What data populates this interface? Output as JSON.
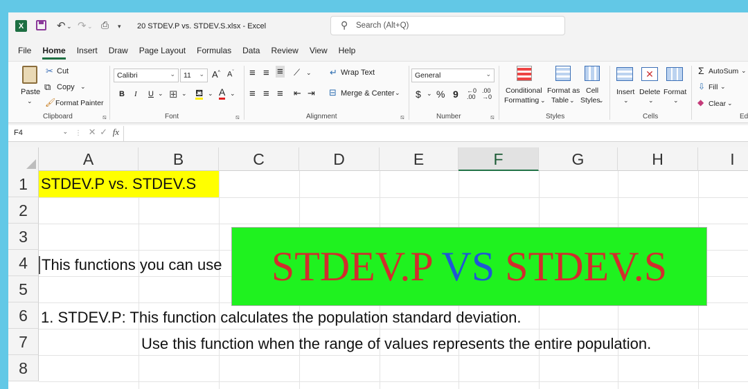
{
  "titlebar": {
    "app_icon": "excel-logo-icon",
    "app_letter": "X",
    "filename": "20 STDEV.P vs. STDEV.S.xlsx",
    "separator": "-",
    "app_name": "Excel",
    "search_placeholder": "Search (Alt+Q)"
  },
  "menu": [
    "File",
    "Home",
    "Insert",
    "Draw",
    "Page Layout",
    "Formulas",
    "Data",
    "Review",
    "View",
    "Help"
  ],
  "ribbon": {
    "clipboard": {
      "paste": "Paste",
      "cut": "Cut",
      "copy": "Copy",
      "format_painter": "Format Painter",
      "label": "Clipboard"
    },
    "font": {
      "name": "Calibri",
      "size": "11",
      "bold": "B",
      "italic": "I",
      "underline": "U",
      "label": "Font"
    },
    "alignment": {
      "wrap_text": "Wrap Text",
      "merge_center": "Merge & Center",
      "label": "Alignment"
    },
    "number": {
      "format": "General",
      "currency": "$",
      "percent": "%",
      "comma": "9",
      "label": "Number"
    },
    "styles": {
      "conditional_1": "Conditional",
      "conditional_2": "Formatting",
      "format_table_1": "Format as",
      "format_table_2": "Table",
      "cell_styles_1": "Cell",
      "cell_styles_2": "Styles",
      "label": "Styles"
    },
    "cells": {
      "insert": "Insert",
      "delete": "Delete",
      "format": "Format",
      "label": "Cells"
    },
    "editing": {
      "autosum": "AutoSum",
      "fill": "Fill",
      "clear": "Clear",
      "label": "Edi"
    }
  },
  "formula_bar": {
    "name_box": "F4",
    "fx": "fx"
  },
  "grid": {
    "columns": [
      "A",
      "B",
      "C",
      "D",
      "E",
      "F",
      "G",
      "H",
      "I"
    ],
    "selected_column": "F",
    "rows": [
      "1",
      "2",
      "3",
      "4",
      "5",
      "6",
      "7",
      "8"
    ],
    "cells": {
      "a1": "STDEV.P vs. STDEV.S",
      "a4": "This functions you can use",
      "a6": "1. STDEV.P: This function calculates the population standard deviation.",
      "b7": "Use this function when the range of values represents the entire population."
    }
  },
  "banner": {
    "left": "STDEV.P",
    "middle": "VS",
    "right": "STDEV.S"
  },
  "colors": {
    "excel_green": "#217346",
    "banner_bg": "#1ff21f",
    "banner_red": "#d12d2d",
    "banner_blue": "#1f57d6",
    "highlight_yellow": "#ffff00"
  }
}
